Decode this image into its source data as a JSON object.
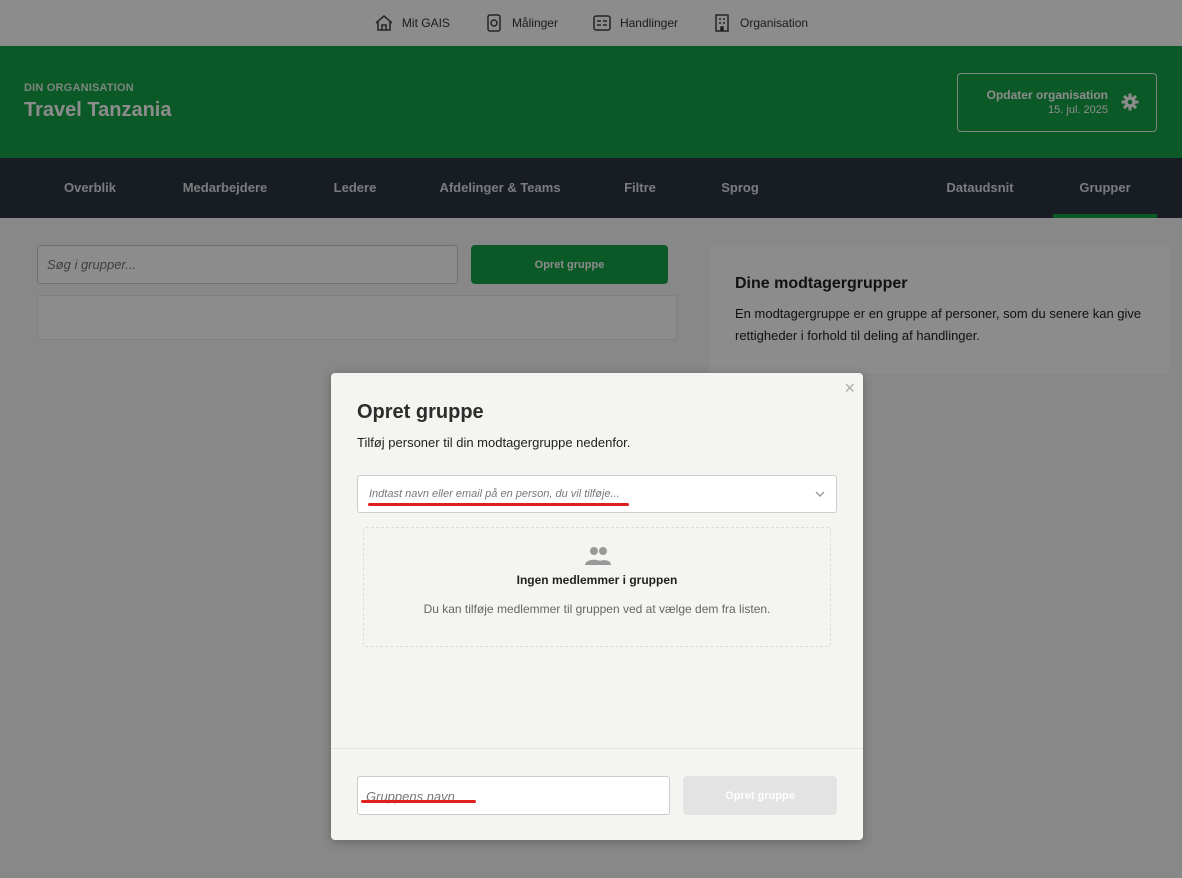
{
  "topnav": [
    {
      "label": "Mit GAIS",
      "icon": "home-icon"
    },
    {
      "label": "Målinger",
      "icon": "survey-icon"
    },
    {
      "label": "Handlinger",
      "icon": "actions-icon"
    },
    {
      "label": "Organisation",
      "icon": "building-icon"
    }
  ],
  "header": {
    "org_label": "DIN ORGANISATION",
    "org_name": "Travel Tanzania",
    "update_label": "Opdater organisation",
    "update_date": "15. jul. 2025"
  },
  "subnav": {
    "tabs": [
      "Overblik",
      "Medarbejdere",
      "Ledere",
      "Afdelinger & Teams",
      "Filtre",
      "Sprog",
      "Dataudsnit",
      "Grupper"
    ],
    "active": "Grupper"
  },
  "content": {
    "search_placeholder": "Søg i grupper...",
    "create_label": "Opret gruppe",
    "info_title": "Dine modtagergrupper",
    "info_text": "En modtagergruppe er en gruppe af personer, som du senere kan give rettigheder i forhold til deling af handlinger."
  },
  "modal": {
    "close": "×",
    "title": "Opret gruppe",
    "subtitle": "Tilføj personer til din modtagergruppe nedenfor.",
    "person_placeholder": "Indtast navn eller email på en person, du vil tilføje...",
    "empty_title": "Ingen medlemmer i gruppen",
    "empty_text": "Du kan tilføje medlemmer til gruppen ved at vælge dem fra listen.",
    "name_placeholder": "Gruppens navn",
    "create_label": "Opret gruppe"
  },
  "colors": {
    "brand_green": "#17a34a",
    "subnav_bg": "#2d3540",
    "annotation_red": "#e01f1f"
  }
}
